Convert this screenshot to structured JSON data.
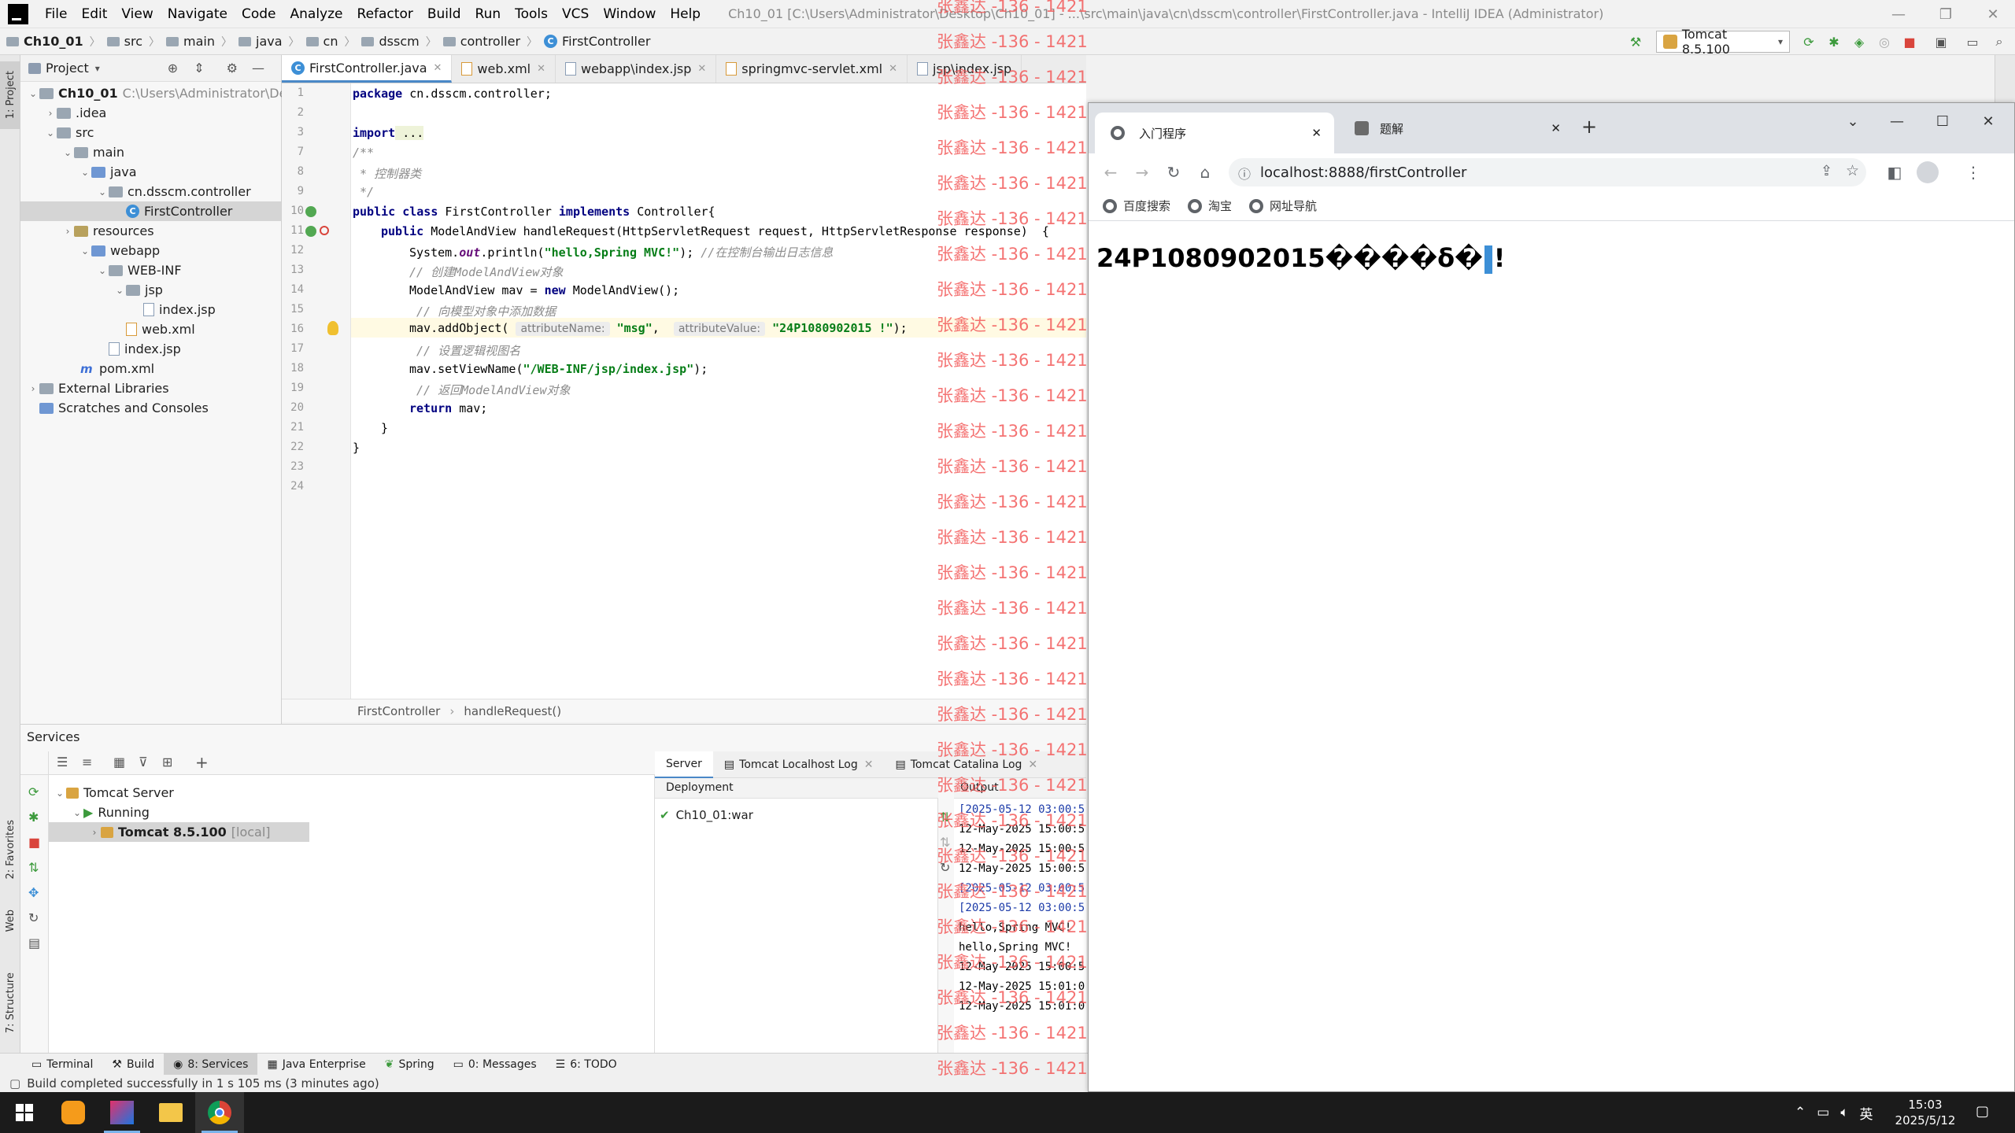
{
  "ide": {
    "menu": [
      "File",
      "Edit",
      "View",
      "Navigate",
      "Code",
      "Analyze",
      "Refactor",
      "Build",
      "Run",
      "Tools",
      "VCS",
      "Window",
      "Help"
    ],
    "window_title": "Ch10_01 [C:\\Users\\Administrator\\Desktop\\Ch10_01] - ...\\src\\main\\java\\cn\\dsscm\\controller\\FirstController.java - IntelliJ IDEA (Administrator)",
    "breadcrumb": [
      "Ch10_01",
      "src",
      "main",
      "java",
      "cn",
      "dsscm",
      "controller",
      "FirstController"
    ],
    "run_config": "Tomcat 8.5.100"
  },
  "project_panel": {
    "title": "Project",
    "tree": [
      {
        "label": "Ch10_01",
        "extra": "C:\\Users\\Administrator\\Desk",
        "arrow": "down",
        "icon": "folder",
        "bold": true
      },
      {
        "label": ".idea",
        "arrow": "right",
        "icon": "folder"
      },
      {
        "label": "src",
        "arrow": "down",
        "icon": "folder"
      },
      {
        "label": "main",
        "arrow": "down",
        "icon": "folder"
      },
      {
        "label": "java",
        "arrow": "down",
        "icon": "folder-blue"
      },
      {
        "label": "cn.dsscm.controller",
        "arrow": "down",
        "icon": "folder"
      },
      {
        "label": "FirstController",
        "arrow": "",
        "icon": "class",
        "selected": true
      },
      {
        "label": "resources",
        "arrow": "right",
        "icon": "folder-res"
      },
      {
        "label": "webapp",
        "arrow": "down",
        "icon": "folder-blue"
      },
      {
        "label": "WEB-INF",
        "arrow": "down",
        "icon": "folder"
      },
      {
        "label": "jsp",
        "arrow": "down",
        "icon": "folder"
      },
      {
        "label": "index.jsp",
        "arrow": "",
        "icon": "file"
      },
      {
        "label": "web.xml",
        "arrow": "",
        "icon": "xml"
      },
      {
        "label": "index.jsp",
        "arrow": "",
        "icon": "file"
      },
      {
        "label": "pom.xml",
        "arrow": "",
        "icon": "maven"
      },
      {
        "label": "External Libraries",
        "arrow": "right",
        "icon": "lib"
      },
      {
        "label": "Scratches and Consoles",
        "arrow": "",
        "icon": "scratch"
      }
    ]
  },
  "editor": {
    "tabs": [
      "FirstController.java",
      "web.xml",
      "webapp\\index.jsp",
      "springmvc-servlet.xml",
      "jsp\\index.jsp"
    ],
    "line_numbers": [
      "1",
      "2",
      "3",
      "7",
      "8",
      "9",
      "10",
      "11",
      "12",
      "13",
      "14",
      "15",
      "16",
      "17",
      "18",
      "19",
      "20",
      "21",
      "22",
      "23",
      "24"
    ],
    "code": {
      "l1_kw": "package",
      "l1": " cn.dsscm.controller;",
      "l3_kw": "import",
      "l3": " ...",
      "l7": "/**",
      "l8": " * 控制器类",
      "l9": " */",
      "l10_kw1": "public class",
      "l10_a": " FirstController ",
      "l10_kw2": "implements",
      "l10_b": " Controller{",
      "l11_kw": "public",
      "l11": " ModelAndView handleRequest(HttpServletRequest request, HttpServletResponse response)  {",
      "l12_a": "System.",
      "l12_f": "out",
      "l12_b": ".println(",
      "l12_s": "\"hello,Spring MVC!\"",
      "l12_c": "); ",
      "l12_cm": "//在控制台输出日志信息",
      "l13": "// 创建ModelAndView对象",
      "l14_a": "ModelAndView mav = ",
      "l14_kw": "new",
      "l14_b": " ModelAndView();",
      "l15": " // 向模型对象中添加数据",
      "l16_a": "mav.addObject( ",
      "l16_h1": "attributeName:",
      "l16_s1": "\"msg\"",
      "l16_c": ",  ",
      "l16_h2": "attributeValue:",
      "l16_s2": "\"24P1080902015 !\"",
      "l16_b": ");",
      "l17": " // 设置逻辑视图名",
      "l18_a": "mav.setViewName(",
      "l18_s": "\"/WEB-INF/jsp/index.jsp\"",
      "l18_b": ");",
      "l19": " // 返回ModelAndView对象",
      "l20_kw": "return",
      "l20": " mav;",
      "l21": "}",
      "l22": "}"
    },
    "breadcrumb": [
      "FirstController",
      "handleRequest()"
    ]
  },
  "services": {
    "title": "Services",
    "tree": [
      {
        "label": "Tomcat Server"
      },
      {
        "label": "Running"
      },
      {
        "label": "Tomcat 8.5.100",
        "extra": "[local]"
      }
    ],
    "tabs": [
      "Server",
      "Tomcat Localhost Log",
      "Tomcat Catalina Log"
    ],
    "deployment_header": "Deployment",
    "deployment_item": "Ch10_01:war",
    "output_header": "Output",
    "output_lines": [
      {
        "text": "[2025-05-12 03:00:5",
        "color": "blue"
      },
      {
        "text": "12-May-2025 15:00:5",
        "color": "black"
      },
      {
        "text": "12-May-2025 15:00:5",
        "color": "black"
      },
      {
        "text": "12-May-2025 15:00:5",
        "color": "black"
      },
      {
        "text": "[2025-05-12 03:00:5",
        "color": "blue"
      },
      {
        "text": "[2025-05-12 03:00:5",
        "color": "blue"
      },
      {
        "text": "hello,Spring MVC!",
        "color": "black"
      },
      {
        "text": "hello,Spring MVC!",
        "color": "black"
      },
      {
        "text": "12-May-2025 15:00:5",
        "color": "black"
      },
      {
        "text": "12-May-2025 15:01:0",
        "color": "black"
      },
      {
        "text": "12-May-2025 15:01:0",
        "color": "black"
      }
    ]
  },
  "bottom_tools": [
    "Terminal",
    "Build",
    "8: Services",
    "Java Enterprise",
    "Spring",
    "0: Messages",
    "6: TODO"
  ],
  "left_stripe": [
    "1: Project",
    "2: Favorites",
    "Web",
    "7: Structure"
  ],
  "status": "Build completed successfully in 1 s 105 ms (3 minutes ago)",
  "browser": {
    "tabs": [
      {
        "title": "入门程序",
        "active": true
      },
      {
        "title": "题解",
        "active": false
      }
    ],
    "url": "localhost:8888/firstController",
    "bookmarks": [
      "百度搜索",
      "淘宝",
      "网址导航"
    ],
    "page_text": "24P1080902015����δ�",
    "page_text_tail": "!"
  },
  "watermark": "张鑫达 -136 - 1421",
  "taskbar": {
    "tray_lang": "英",
    "time": "15:03",
    "date": "2025/5/12"
  },
  "colors": {
    "accent": "#4a88c7",
    "watermark": "#f35b5b",
    "string": "#067d17",
    "keyword": "#000080"
  }
}
